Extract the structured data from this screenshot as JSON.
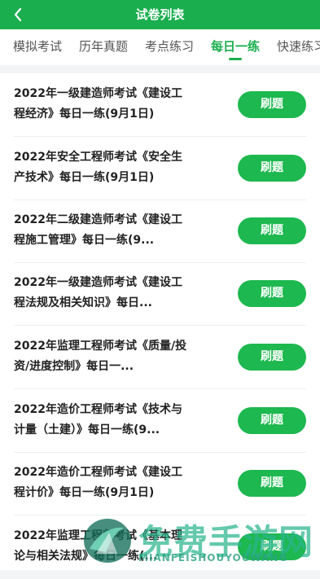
{
  "header": {
    "title": "试卷列表"
  },
  "tabs": [
    {
      "label": "模拟考试"
    },
    {
      "label": "历年真题"
    },
    {
      "label": "考点练习"
    },
    {
      "label": "每日一练",
      "active": true
    },
    {
      "label": "快速练习"
    }
  ],
  "items": [
    {
      "title": "2022年一级建造师考试《建设工程经济》每日一练(9月1日)",
      "button": "刷题"
    },
    {
      "title": "2022年安全工程师考试《安全生产技术》每日一练(9月1日)",
      "button": "刷题"
    },
    {
      "title": "2022年二级建造师考试《建设工程施工管理》每日一练(9...",
      "button": "刷题"
    },
    {
      "title": "2022年一级建造师考试《建设工程法规及相关知识》每日...",
      "button": "刷题"
    },
    {
      "title": "2022年监理工程师考试《质量/投资/进度控制》每日一...",
      "button": "刷题"
    },
    {
      "title": "2022年造价工程师考试《技术与计量（土建）》每日一练(9...",
      "button": "刷题"
    },
    {
      "title": "2022年造价工程师考试《建设工程计价》每日一练(9月1日)",
      "button": "刷题"
    },
    {
      "title": "2022年监理工程师考试《基本理论与相关法规》每日一练(...",
      "button": "刷题"
    }
  ],
  "watermark": {
    "main": "免费手游网",
    "sub": "MIANFEISHOUYOUWANG"
  },
  "colors": {
    "primary": "#1aae4e",
    "button": "#1db84f"
  }
}
